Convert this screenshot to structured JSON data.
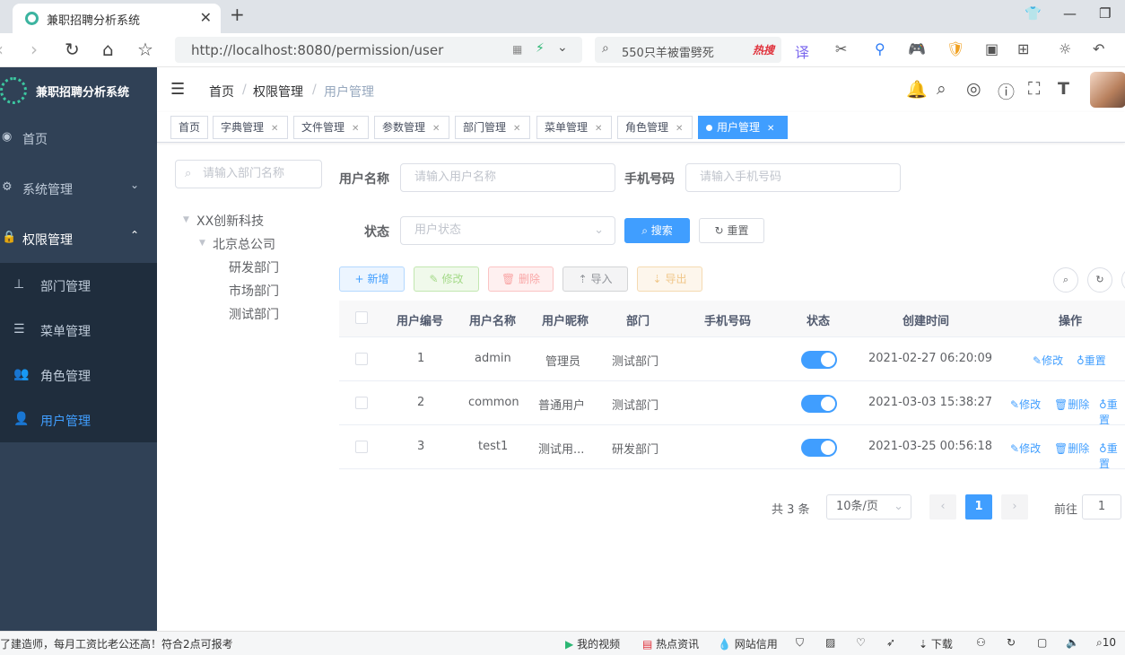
{
  "browser": {
    "tab_title": "兼职招聘分析系统",
    "url": "http://localhost:8080/permission/user",
    "search_query": "550只羊被雷劈死",
    "search_hot": "热搜"
  },
  "sidebar": {
    "brand": "兼职招聘分析系统",
    "items": [
      {
        "label": "首页"
      },
      {
        "label": "系统管理"
      },
      {
        "label": "权限管理"
      }
    ],
    "sub_items": [
      {
        "label": "部门管理"
      },
      {
        "label": "菜单管理"
      },
      {
        "label": "角色管理"
      },
      {
        "label": "用户管理"
      }
    ]
  },
  "header": {
    "breadcrumb": [
      "首页",
      "权限管理",
      "/",
      "用户管理"
    ]
  },
  "tags": [
    "首页",
    "字典管理",
    "文件管理",
    "参数管理",
    "部门管理",
    "菜单管理",
    "角色管理",
    "用户管理"
  ],
  "dept_tree": {
    "search_placeholder": "请输入部门名称",
    "root": "XX创新科技",
    "company": "北京总公司",
    "departments": [
      "研发部门",
      "市场部门",
      "测试部门"
    ]
  },
  "filter": {
    "username_label": "用户名称",
    "username_placeholder": "请输入用户名称",
    "phone_label": "手机号码",
    "phone_placeholder": "请输入手机号码",
    "status_label": "状态",
    "status_placeholder": "用户状态",
    "search_button": "搜索",
    "reset_button": "重置"
  },
  "toolbar": {
    "add": "新增",
    "edit": "修改",
    "delete": "删除",
    "import": "导入",
    "export": "导出"
  },
  "table": {
    "columns": [
      "用户编号",
      "用户名称",
      "用户昵称",
      "部门",
      "手机号码",
      "状态",
      "创建时间",
      "操作"
    ],
    "rows": [
      {
        "id": "1",
        "username": "admin",
        "nickname": "管理员",
        "dept": "测试部门",
        "phone": "",
        "status": true,
        "created": "2021-02-27 06:20:09"
      },
      {
        "id": "2",
        "username": "common",
        "nickname": "普通用户",
        "dept": "测试部门",
        "phone": "",
        "status": true,
        "created": "2021-03-03 15:38:27"
      },
      {
        "id": "3",
        "username": "test1",
        "nickname": "测试用...",
        "dept": "研发部门",
        "phone": "",
        "status": true,
        "created": "2021-03-25 00:56:18"
      }
    ],
    "ops": {
      "edit": "修改",
      "delete": "删除",
      "reset": "重置"
    }
  },
  "pagination": {
    "total": "共 3 条",
    "page_size": "10条/页",
    "current": "1",
    "goto_label": "前往",
    "goto_value": "1"
  },
  "statusbar": {
    "news": "了建造师，每月工资比老公还高！符合2点可报考",
    "items": [
      "我的视频",
      "热点资讯",
      "网站信用",
      "下载"
    ],
    "zoom": "10"
  },
  "colors": {
    "sidebar_bg": "#304156",
    "submenu_bg": "#1f2d3d",
    "primary": "#409eff"
  }
}
